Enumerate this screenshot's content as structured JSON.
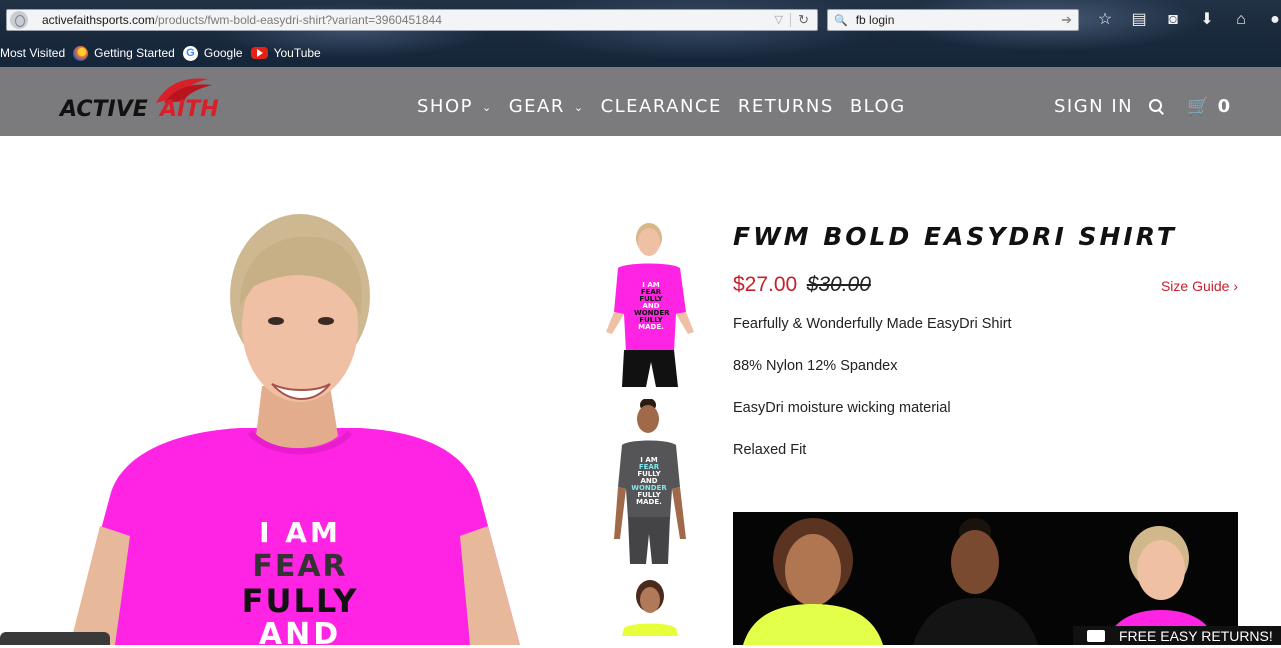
{
  "browser": {
    "url_domain": "activefaithsports.com",
    "url_path": "/products/fwm-bold-easydri-shirt?variant=3960451844",
    "search_value": "fb login",
    "bookmarks": [
      {
        "label": "Most Visited",
        "icon": "none"
      },
      {
        "label": "Getting Started",
        "icon": "firefox-icon"
      },
      {
        "label": "Google",
        "icon": "google-icon"
      },
      {
        "label": "YouTube",
        "icon": "youtube-icon"
      }
    ],
    "toolbar_icons": [
      "star-icon",
      "reading-list-icon",
      "pocket-icon",
      "download-icon",
      "home-icon",
      "chat-icon"
    ]
  },
  "site": {
    "logo_word1": "ACTIVE",
    "logo_word2": "AITH",
    "nav": [
      {
        "label": "SHOP",
        "has_dropdown": true
      },
      {
        "label": "GEAR",
        "has_dropdown": true
      },
      {
        "label": "CLEARANCE",
        "has_dropdown": false
      },
      {
        "label": "RETURNS",
        "has_dropdown": false
      },
      {
        "label": "BLOG",
        "has_dropdown": false
      }
    ],
    "sign_in": "SIGN IN",
    "cart_count": "0",
    "header_color": "#7b7b7d",
    "accent_color": "#c8202c"
  },
  "product": {
    "title": "FWM BOLD EASYDRI SHIRT",
    "price_sale": "$27.00",
    "price_original": "$30.00",
    "size_guide": "Size Guide ›",
    "details": [
      "Fearfully & Wonderfully Made EasyDri Shirt",
      "88% Nylon 12% Spandex",
      "EasyDri moisture wicking material",
      "Relaxed Fit"
    ],
    "hero_shirt_text": [
      "I AM",
      "FEAR",
      "FULLY",
      "AND"
    ],
    "thumb1_shirt_text": [
      "I AM",
      "FEAR",
      "FULLY",
      "AND",
      "WONDER",
      "FULLY",
      "MADE."
    ],
    "thumb2_shirt_text": [
      "I AM",
      "FEAR",
      "FULLY",
      "AND",
      "WONDER",
      "FULLY",
      "MADE."
    ]
  },
  "footer": {
    "returns_text": "FREE EASY RETURNS!"
  }
}
